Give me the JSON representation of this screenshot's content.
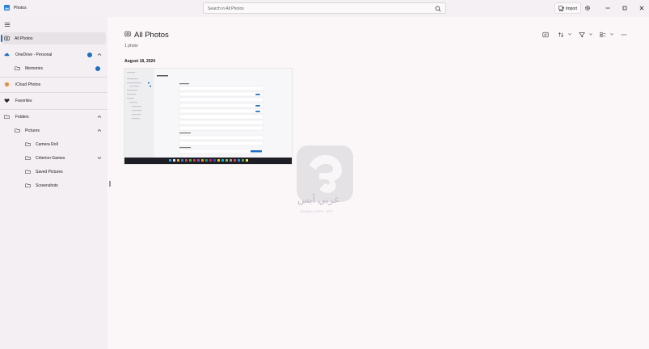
{
  "app": {
    "title": "Photos"
  },
  "search": {
    "placeholder": "Search in All Photos"
  },
  "header": {
    "import_label": "Import"
  },
  "sidebar": {
    "items": [
      {
        "label": "All Photos"
      },
      {
        "label": "OneDrive - Personal"
      },
      {
        "label": "Memories"
      },
      {
        "label": "iCloud Photos"
      },
      {
        "label": "Favorites"
      },
      {
        "label": "Folders"
      },
      {
        "label": "Pictures"
      },
      {
        "label": "Camera Roll"
      },
      {
        "label": "Criterion Games"
      },
      {
        "label": "Saved Pictures"
      },
      {
        "label": "Screenshots"
      }
    ]
  },
  "main": {
    "title": "All Photos",
    "count": "1 photo",
    "groups": [
      {
        "date": "August 18, 2024"
      }
    ]
  },
  "watermark": {
    "text": "عربي آبس",
    "sub": "ARABIC APPS .NET"
  },
  "colors": {
    "accent": "#1f6fc0",
    "sidebar_bg": "#f3eff2",
    "main_bg": "#fbf7f9"
  }
}
